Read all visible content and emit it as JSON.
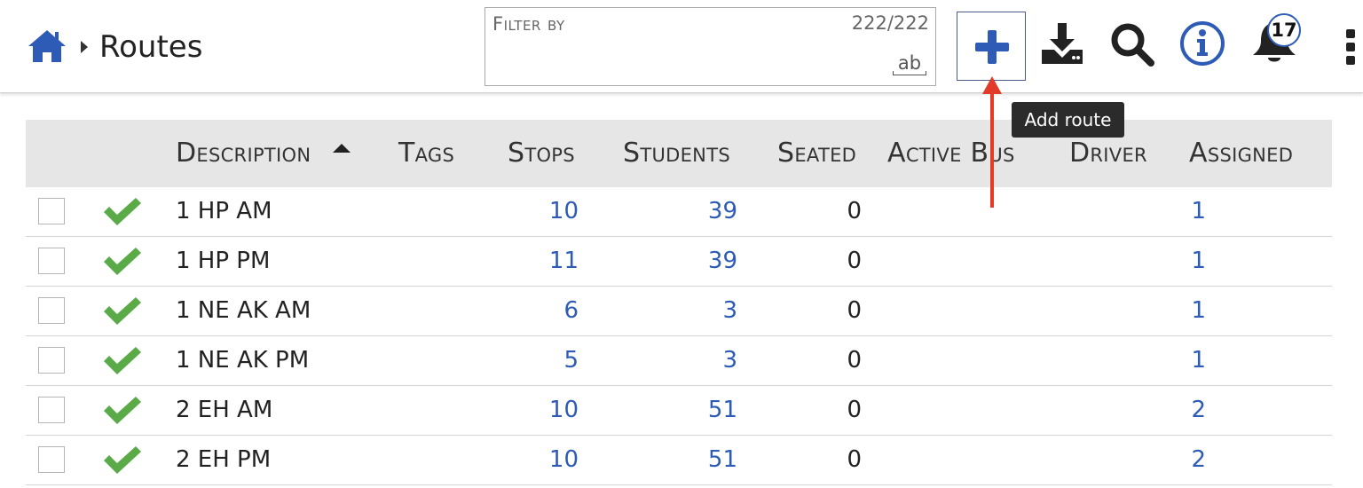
{
  "breadcrumb": {
    "home_icon": "home-icon",
    "separator_icon": "caret-right-icon",
    "title": "Routes"
  },
  "filter": {
    "label": "Filter by",
    "count": "222/222",
    "match_mode_label": "ab"
  },
  "toolbar": {
    "add_icon": "plus-icon",
    "download_icon": "download-icon",
    "search_icon": "search-icon",
    "info_icon": "info-icon",
    "notifications_icon": "bell-icon",
    "notifications_count": "17",
    "more_icon": "kebab-icon"
  },
  "tooltip": {
    "text": "Add route"
  },
  "colors": {
    "accent": "#2d5bb5",
    "check": "#5aaa47",
    "annotation_arrow": "#e23b2a",
    "header_bg": "#e6e6e6"
  },
  "table": {
    "columns": [
      "Description",
      "Tags",
      "Stops",
      "Students",
      "Seated",
      "Active Bus",
      "Driver",
      "Assigned"
    ],
    "sorted_column": "Description",
    "sort_direction": "ascending",
    "rows": [
      {
        "description": "1 HP AM",
        "tags": "",
        "stops": "10",
        "students": "39",
        "seated": "0",
        "active_bus": "",
        "driver": "",
        "assigned": "1"
      },
      {
        "description": "1 HP PM",
        "tags": "",
        "stops": "11",
        "students": "39",
        "seated": "0",
        "active_bus": "",
        "driver": "",
        "assigned": "1"
      },
      {
        "description": "1 NE AK AM",
        "tags": "",
        "stops": "6",
        "students": "3",
        "seated": "0",
        "active_bus": "",
        "driver": "",
        "assigned": "1"
      },
      {
        "description": "1 NE AK PM",
        "tags": "",
        "stops": "5",
        "students": "3",
        "seated": "0",
        "active_bus": "",
        "driver": "",
        "assigned": "1"
      },
      {
        "description": "2 EH AM",
        "tags": "",
        "stops": "10",
        "students": "51",
        "seated": "0",
        "active_bus": "",
        "driver": "",
        "assigned": "2"
      },
      {
        "description": "2 EH PM",
        "tags": "",
        "stops": "10",
        "students": "51",
        "seated": "0",
        "active_bus": "",
        "driver": "",
        "assigned": "2"
      }
    ]
  }
}
